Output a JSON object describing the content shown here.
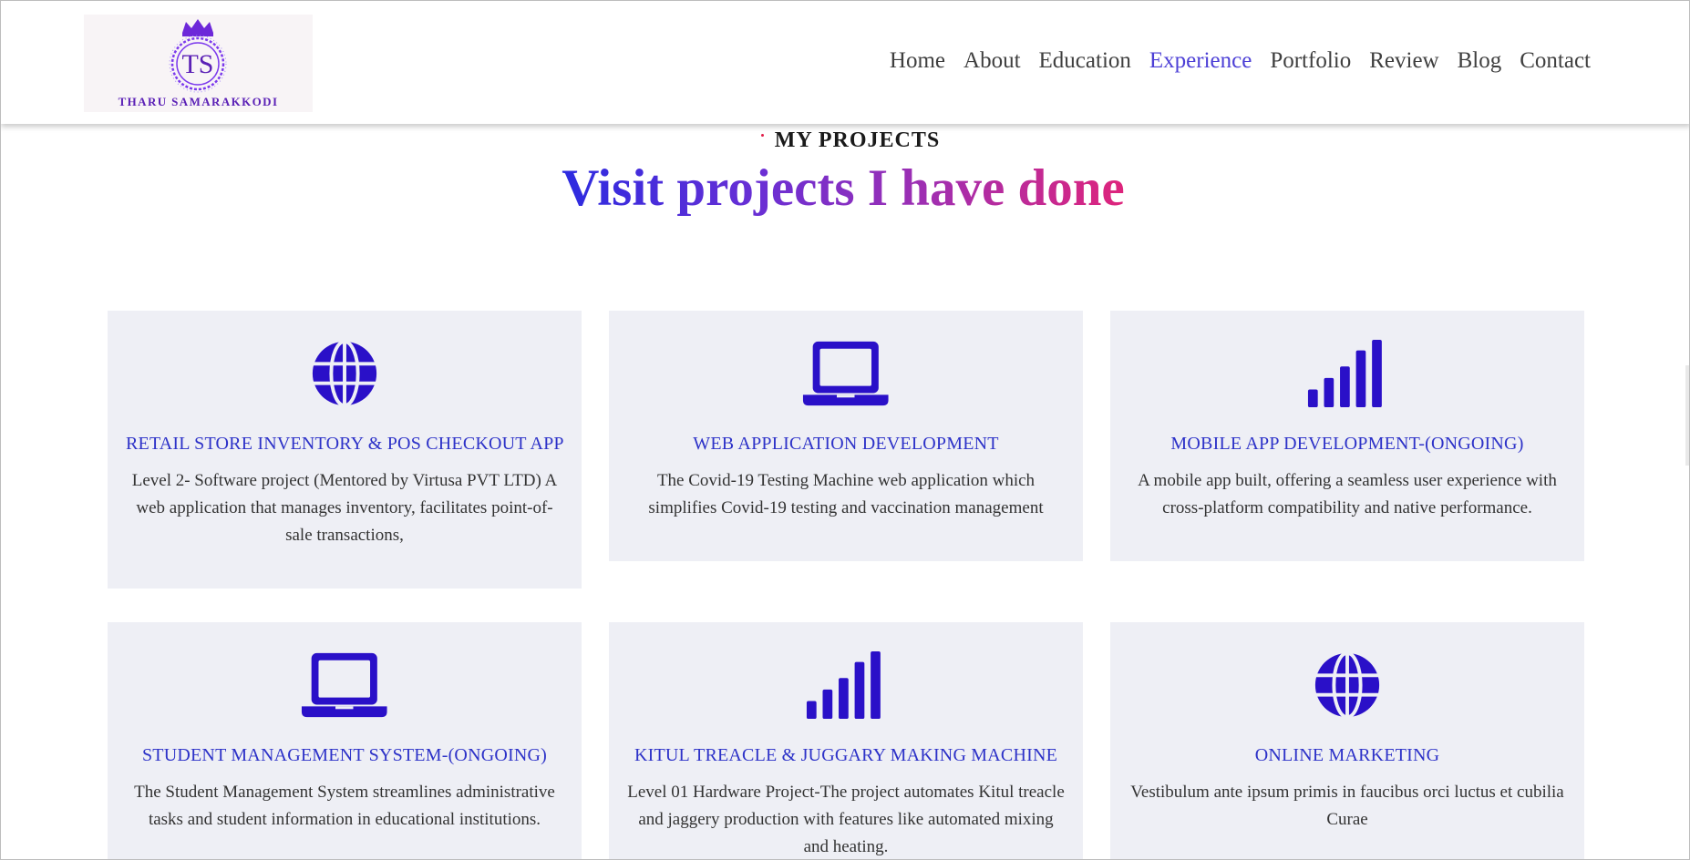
{
  "brand": {
    "logo_monogram": "TS",
    "logo_text": "THARU SAMARAKKODI"
  },
  "nav": {
    "items": [
      {
        "label": "Home",
        "active": false
      },
      {
        "label": "About",
        "active": false
      },
      {
        "label": "Education",
        "active": false
      },
      {
        "label": "Experience",
        "active": true
      },
      {
        "label": "Portfolio",
        "active": false
      },
      {
        "label": "Review",
        "active": false
      },
      {
        "label": "Blog",
        "active": false
      },
      {
        "label": "Contact",
        "active": false
      }
    ]
  },
  "section": {
    "eyebrow": "MY PROJECTS",
    "title": "Visit projects I have done"
  },
  "colors": {
    "accent": "#2d32c8",
    "icon": "#2a10c8",
    "card_bg": "#eeeff5",
    "nav_active": "#4c3fd6"
  },
  "projects": [
    {
      "icon": "globe-icon",
      "title": "RETAIL STORE INVENTORY & POS CHECKOUT APP",
      "description": "Level 2- Software project (Mentored by Virtusa PVT LTD) A web application that manages inventory, facilitates point-of-sale transactions,"
    },
    {
      "icon": "laptop-icon",
      "title": "WEB APPLICATION DEVELOPMENT",
      "description": "The Covid-19 Testing Machine web application which simplifies Covid-19 testing and vaccination management"
    },
    {
      "icon": "signal-bars-icon",
      "title": "MOBILE APP DEVELOPMENT-(ONGOING)",
      "description": "A mobile app built, offering a seamless user experience with cross-platform compatibility and native performance."
    },
    {
      "icon": "laptop-icon",
      "title": "STUDENT MANAGEMENT SYSTEM-(ONGOING)",
      "description": "The Student Management System streamlines administrative tasks and student information in educational institutions."
    },
    {
      "icon": "signal-bars-icon",
      "title": "KITUL TREACLE & JUGGARY MAKING MACHINE",
      "description": "Level 01 Hardware Project-The project automates Kitul treacle and jaggery production with features like automated mixing and heating."
    },
    {
      "icon": "globe-icon",
      "title": "ONLINE MARKETING",
      "description": "Vestibulum ante ipsum primis in faucibus orci luctus et cubilia Curae"
    }
  ]
}
